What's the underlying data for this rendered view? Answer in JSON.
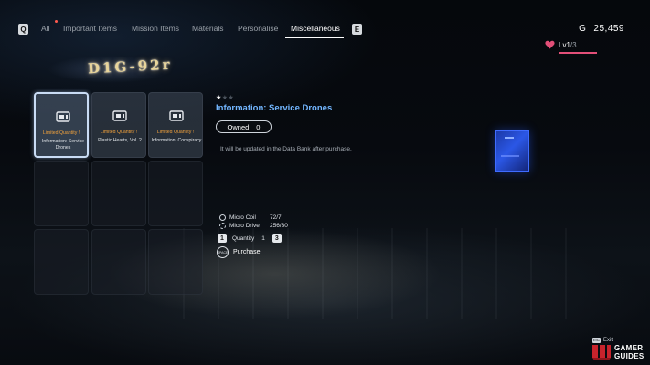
{
  "nav": {
    "prev_key": "Q",
    "next_key": "E",
    "tabs": [
      {
        "label": "All"
      },
      {
        "label": "Important Items"
      },
      {
        "label": "Mission Items"
      },
      {
        "label": "Materials"
      },
      {
        "label": "Personalise"
      },
      {
        "label": "Miscellaneous"
      }
    ],
    "active_tab": "Miscellaneous"
  },
  "currency": {
    "symbol": "G",
    "amount": "25,459"
  },
  "level": {
    "label": "Lv1",
    "max": "/3",
    "progress": 1.0
  },
  "shop_sign": {
    "text": "D1G-92r"
  },
  "grid": {
    "items": [
      {
        "limited": "Limited Quantity !",
        "name": "Information: Service Drones",
        "selected": true,
        "icon": "data-chip-icon"
      },
      {
        "limited": "Limited Quantity !",
        "name": "Plastic Hearts, Vol. 2",
        "selected": false,
        "icon": "data-chip-icon"
      },
      {
        "limited": "Limited Quantity !",
        "name": "Information: Conspiracy",
        "selected": false,
        "icon": "data-chip-icon"
      }
    ]
  },
  "detail": {
    "rarity": 1,
    "rarity_max": 3,
    "title": "Information: Service Drones",
    "owned_label": "Owned",
    "owned_value": "0",
    "description": "It will be updated in the Data Bank after purchase."
  },
  "materials": [
    {
      "name": "Micro Coil",
      "value": "72/7",
      "icon": "micro-coil-icon"
    },
    {
      "name": "Micro Drive",
      "value": "256/30",
      "icon": "micro-drive-icon"
    }
  ],
  "quantity": {
    "dec_key": "1",
    "label": "Quantity",
    "value": "1",
    "inc_key": "3"
  },
  "purchase": {
    "key": "SPACE",
    "label": "Purchase"
  },
  "exit": {
    "key": "ESC",
    "label": "Exit"
  },
  "watermark": {
    "line1": "GAMER",
    "line2": "GUIDES"
  },
  "colors": {
    "accent_blue": "#72b6ff",
    "limited_orange": "#f2a23c",
    "heart_pink": "#e24f78"
  }
}
